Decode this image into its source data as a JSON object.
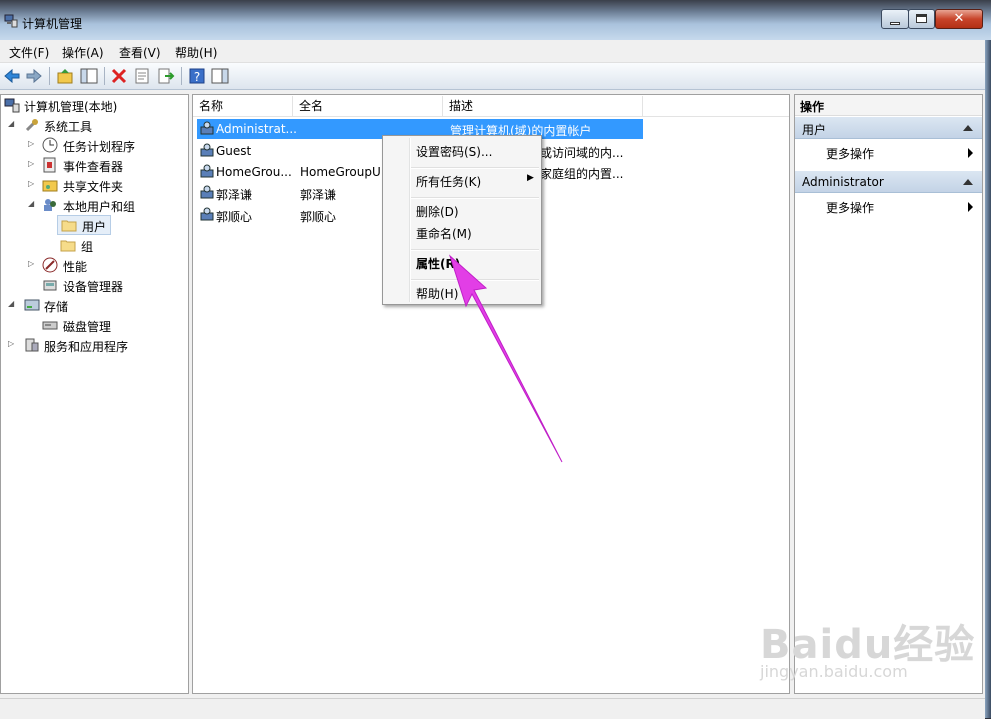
{
  "window": {
    "title": "计算机管理"
  },
  "menu": [
    "文件(F)",
    "操作(A)",
    "查看(V)",
    "帮助(H)"
  ],
  "toolbar": [
    "back-icon",
    "forward-icon",
    "up-folder-icon",
    "show-hide-tree-icon",
    "delete-icon",
    "properties-icon",
    "export-icon",
    "help-icon",
    "show-action-pane-icon"
  ],
  "tree": [
    {
      "label": "计算机管理(本地)",
      "icon": "computer-management-icon"
    },
    {
      "label": "系统工具",
      "icon": "tools-icon"
    },
    {
      "label": "任务计划程序",
      "icon": "clock-icon"
    },
    {
      "label": "事件查看器",
      "icon": "event-viewer-icon"
    },
    {
      "label": "共享文件夹",
      "icon": "shared-folder-icon"
    },
    {
      "label": "本地用户和组",
      "icon": "users-groups-icon"
    },
    {
      "label": "用户",
      "icon": "folder-icon"
    },
    {
      "label": "组",
      "icon": "folder-icon"
    },
    {
      "label": "性能",
      "icon": "performance-icon"
    },
    {
      "label": "设备管理器",
      "icon": "device-manager-icon"
    },
    {
      "label": "存储",
      "icon": "storage-icon"
    },
    {
      "label": "磁盘管理",
      "icon": "disk-icon"
    },
    {
      "label": "服务和应用程序",
      "icon": "services-icon"
    }
  ],
  "list": {
    "columns": [
      "名称",
      "全名",
      "描述"
    ],
    "rows": [
      {
        "name": "Administrat...",
        "full": "",
        "desc": "管理计算机(域)的内置帐户"
      },
      {
        "name": "Guest",
        "full": "",
        "desc": "或访问域的内..."
      },
      {
        "name": "HomeGrou...",
        "full": "HomeGroupU",
        "desc": "家庭组的内置..."
      },
      {
        "name": "郭泽谦",
        "full": "郭泽谦",
        "desc": ""
      },
      {
        "name": "郭顺心",
        "full": "郭顺心",
        "desc": ""
      }
    ]
  },
  "context_menu": [
    "设置密码(S)...",
    "所有任务(K)",
    "删除(D)",
    "重命名(M)",
    "属性(R)",
    "帮助(H)"
  ],
  "actions": {
    "header": "操作",
    "groups": [
      {
        "title": "用户",
        "item": "更多操作"
      },
      {
        "title": "Administrator",
        "item": "更多操作"
      }
    ]
  },
  "watermark": {
    "logo": "Baidu经验",
    "url": "jingyan.baidu.com"
  },
  "colors": {
    "selection": "#3399ff",
    "arrow": "#e23ee6"
  }
}
